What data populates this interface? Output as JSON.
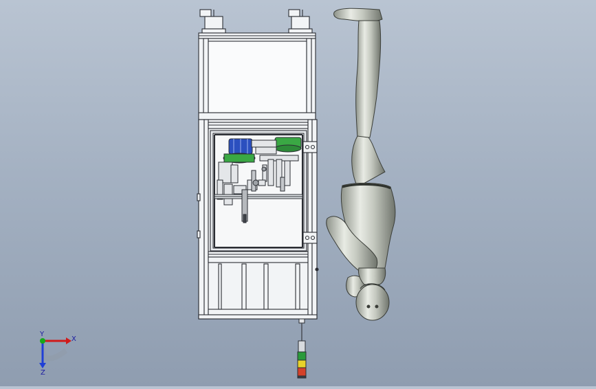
{
  "view": {
    "name": "cad-3d-viewport",
    "background_top": "#b9c4d2",
    "background_bottom": "#8f9db0"
  },
  "model": {
    "frame_color": "#f2f4f6",
    "blue_part_color": "#2b4fbf",
    "green_part_color": "#3aa844",
    "mannequin_color": "#c9ccc4",
    "stack_light_colors": [
      "#2a9a3a",
      "#e8d22a",
      "#d4412a"
    ]
  },
  "triad": {
    "x_label": "X",
    "y_label": "Y",
    "z_label": "Z",
    "x_color": "#d11a1a",
    "y_color": "#18a818",
    "z_color": "#1f3fd6"
  }
}
